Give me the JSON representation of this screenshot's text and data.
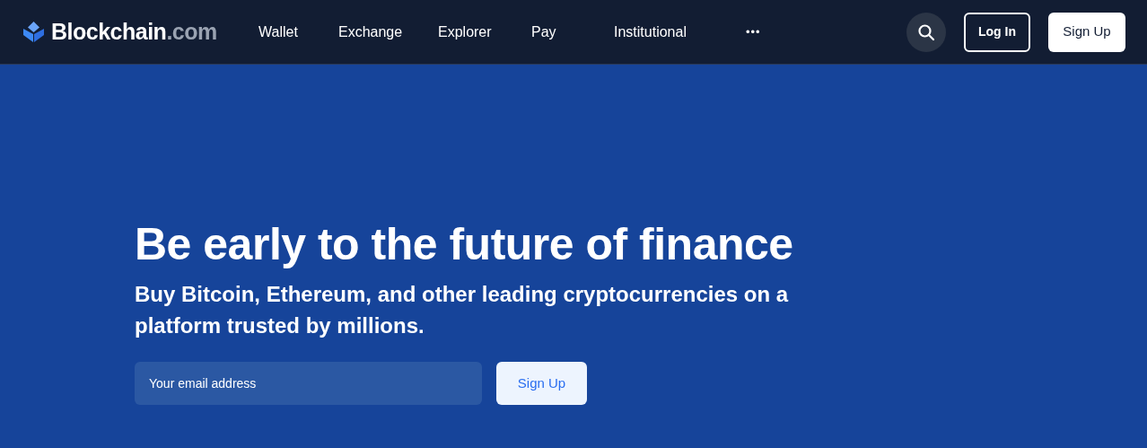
{
  "header": {
    "logo": {
      "name": "Blockchain",
      "suffix": ".com"
    },
    "nav": [
      "Wallet",
      "Exchange",
      "Explorer",
      "Pay",
      "Institutional"
    ],
    "more": "•••",
    "login": "Log In",
    "signup": "Sign Up"
  },
  "hero": {
    "title": "Be early to the future of finance",
    "subtitle": "Buy Bitcoin, Ethereum, and other leading cryptocurrencies on a platform trusted by millions.",
    "email": {
      "placeholder": "Your email address"
    },
    "button": "Sign Up"
  }
}
